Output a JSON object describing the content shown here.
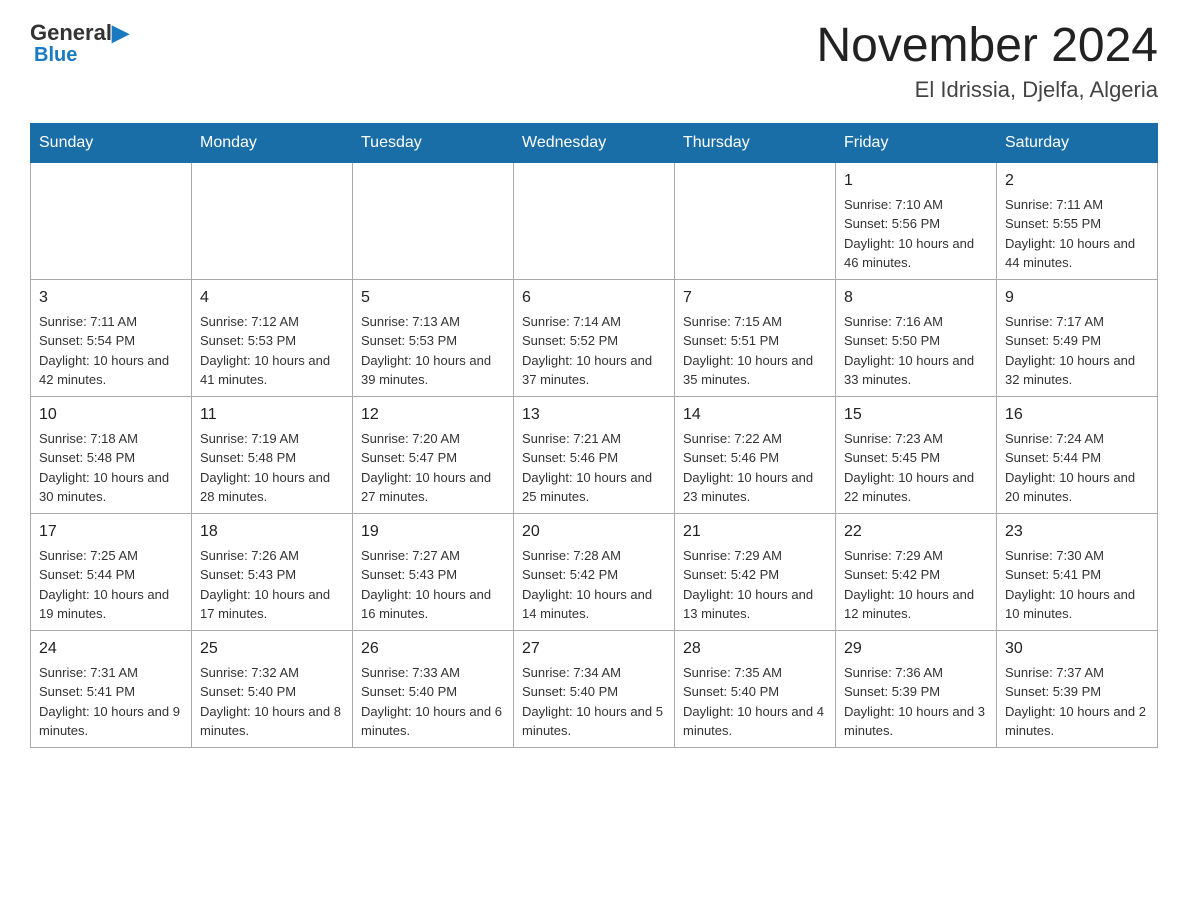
{
  "header": {
    "logo_general": "General",
    "logo_blue": "Blue",
    "title": "November 2024",
    "subtitle": "El Idrissia, Djelfa, Algeria"
  },
  "days_of_week": [
    "Sunday",
    "Monday",
    "Tuesday",
    "Wednesday",
    "Thursday",
    "Friday",
    "Saturday"
  ],
  "weeks": [
    [
      {
        "day": "",
        "info": ""
      },
      {
        "day": "",
        "info": ""
      },
      {
        "day": "",
        "info": ""
      },
      {
        "day": "",
        "info": ""
      },
      {
        "day": "",
        "info": ""
      },
      {
        "day": "1",
        "info": "Sunrise: 7:10 AM\nSunset: 5:56 PM\nDaylight: 10 hours and 46 minutes."
      },
      {
        "day": "2",
        "info": "Sunrise: 7:11 AM\nSunset: 5:55 PM\nDaylight: 10 hours and 44 minutes."
      }
    ],
    [
      {
        "day": "3",
        "info": "Sunrise: 7:11 AM\nSunset: 5:54 PM\nDaylight: 10 hours and 42 minutes."
      },
      {
        "day": "4",
        "info": "Sunrise: 7:12 AM\nSunset: 5:53 PM\nDaylight: 10 hours and 41 minutes."
      },
      {
        "day": "5",
        "info": "Sunrise: 7:13 AM\nSunset: 5:53 PM\nDaylight: 10 hours and 39 minutes."
      },
      {
        "day": "6",
        "info": "Sunrise: 7:14 AM\nSunset: 5:52 PM\nDaylight: 10 hours and 37 minutes."
      },
      {
        "day": "7",
        "info": "Sunrise: 7:15 AM\nSunset: 5:51 PM\nDaylight: 10 hours and 35 minutes."
      },
      {
        "day": "8",
        "info": "Sunrise: 7:16 AM\nSunset: 5:50 PM\nDaylight: 10 hours and 33 minutes."
      },
      {
        "day": "9",
        "info": "Sunrise: 7:17 AM\nSunset: 5:49 PM\nDaylight: 10 hours and 32 minutes."
      }
    ],
    [
      {
        "day": "10",
        "info": "Sunrise: 7:18 AM\nSunset: 5:48 PM\nDaylight: 10 hours and 30 minutes."
      },
      {
        "day": "11",
        "info": "Sunrise: 7:19 AM\nSunset: 5:48 PM\nDaylight: 10 hours and 28 minutes."
      },
      {
        "day": "12",
        "info": "Sunrise: 7:20 AM\nSunset: 5:47 PM\nDaylight: 10 hours and 27 minutes."
      },
      {
        "day": "13",
        "info": "Sunrise: 7:21 AM\nSunset: 5:46 PM\nDaylight: 10 hours and 25 minutes."
      },
      {
        "day": "14",
        "info": "Sunrise: 7:22 AM\nSunset: 5:46 PM\nDaylight: 10 hours and 23 minutes."
      },
      {
        "day": "15",
        "info": "Sunrise: 7:23 AM\nSunset: 5:45 PM\nDaylight: 10 hours and 22 minutes."
      },
      {
        "day": "16",
        "info": "Sunrise: 7:24 AM\nSunset: 5:44 PM\nDaylight: 10 hours and 20 minutes."
      }
    ],
    [
      {
        "day": "17",
        "info": "Sunrise: 7:25 AM\nSunset: 5:44 PM\nDaylight: 10 hours and 19 minutes."
      },
      {
        "day": "18",
        "info": "Sunrise: 7:26 AM\nSunset: 5:43 PM\nDaylight: 10 hours and 17 minutes."
      },
      {
        "day": "19",
        "info": "Sunrise: 7:27 AM\nSunset: 5:43 PM\nDaylight: 10 hours and 16 minutes."
      },
      {
        "day": "20",
        "info": "Sunrise: 7:28 AM\nSunset: 5:42 PM\nDaylight: 10 hours and 14 minutes."
      },
      {
        "day": "21",
        "info": "Sunrise: 7:29 AM\nSunset: 5:42 PM\nDaylight: 10 hours and 13 minutes."
      },
      {
        "day": "22",
        "info": "Sunrise: 7:29 AM\nSunset: 5:42 PM\nDaylight: 10 hours and 12 minutes."
      },
      {
        "day": "23",
        "info": "Sunrise: 7:30 AM\nSunset: 5:41 PM\nDaylight: 10 hours and 10 minutes."
      }
    ],
    [
      {
        "day": "24",
        "info": "Sunrise: 7:31 AM\nSunset: 5:41 PM\nDaylight: 10 hours and 9 minutes."
      },
      {
        "day": "25",
        "info": "Sunrise: 7:32 AM\nSunset: 5:40 PM\nDaylight: 10 hours and 8 minutes."
      },
      {
        "day": "26",
        "info": "Sunrise: 7:33 AM\nSunset: 5:40 PM\nDaylight: 10 hours and 6 minutes."
      },
      {
        "day": "27",
        "info": "Sunrise: 7:34 AM\nSunset: 5:40 PM\nDaylight: 10 hours and 5 minutes."
      },
      {
        "day": "28",
        "info": "Sunrise: 7:35 AM\nSunset: 5:40 PM\nDaylight: 10 hours and 4 minutes."
      },
      {
        "day": "29",
        "info": "Sunrise: 7:36 AM\nSunset: 5:39 PM\nDaylight: 10 hours and 3 minutes."
      },
      {
        "day": "30",
        "info": "Sunrise: 7:37 AM\nSunset: 5:39 PM\nDaylight: 10 hours and 2 minutes."
      }
    ]
  ]
}
